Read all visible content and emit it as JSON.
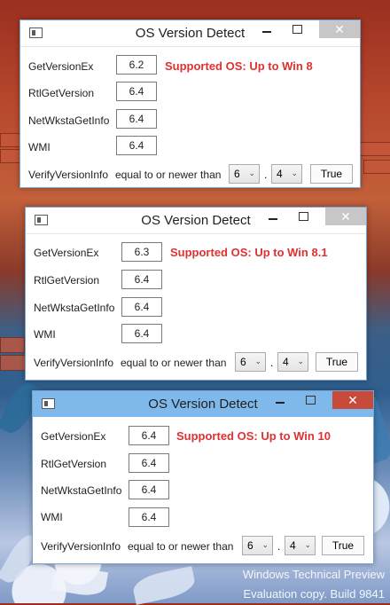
{
  "windows": [
    {
      "title": "OS Version Detect",
      "rows": [
        {
          "label": "GetVersionEx",
          "value": "6.2"
        },
        {
          "label": "RtlGetVersion",
          "value": "6.4"
        },
        {
          "label": "NetWkstaGetInfo",
          "value": "6.4"
        },
        {
          "label": "WMI",
          "value": "6.4"
        }
      ],
      "supported": "Supported OS: Up to Win 8",
      "verify_label": "VerifyVersionInfo",
      "verify_text": "equal to or newer than",
      "major": "6",
      "minor": "4",
      "dot": ".",
      "result": "True",
      "active": false
    },
    {
      "title": "OS Version Detect",
      "rows": [
        {
          "label": "GetVersionEx",
          "value": "6.3"
        },
        {
          "label": "RtlGetVersion",
          "value": "6.4"
        },
        {
          "label": "NetWkstaGetInfo",
          "value": "6.4"
        },
        {
          "label": "WMI",
          "value": "6.4"
        }
      ],
      "supported": "Supported OS: Up to Win 8.1",
      "verify_label": "VerifyVersionInfo",
      "verify_text": "equal to or newer than",
      "major": "6",
      "minor": "4",
      "dot": ".",
      "result": "True",
      "active": false
    },
    {
      "title": "OS Version Detect",
      "rows": [
        {
          "label": "GetVersionEx",
          "value": "6.4"
        },
        {
          "label": "RtlGetVersion",
          "value": "6.4"
        },
        {
          "label": "NetWkstaGetInfo",
          "value": "6.4"
        },
        {
          "label": "WMI",
          "value": "6.4"
        }
      ],
      "supported": "Supported OS: Up to Win 10",
      "verify_label": "VerifyVersionInfo",
      "verify_text": "equal to or newer than",
      "major": "6",
      "minor": "4",
      "dot": ".",
      "result": "True",
      "active": true
    }
  ],
  "controls": {
    "minimize": "—",
    "close": "✕"
  },
  "icons": {
    "app": "app-window-icon",
    "minimize": "minimize-icon",
    "maximize": "maximize-icon",
    "close": "close-icon",
    "dropdown": "chevron-down-icon"
  },
  "colors": {
    "supported_text": "#e03131",
    "active_title": "#7fb8ea",
    "close_active": "#c74a3a"
  },
  "watermark": {
    "line1": "Windows Technical Preview",
    "line2": "Evaluation copy. Build 9841"
  }
}
